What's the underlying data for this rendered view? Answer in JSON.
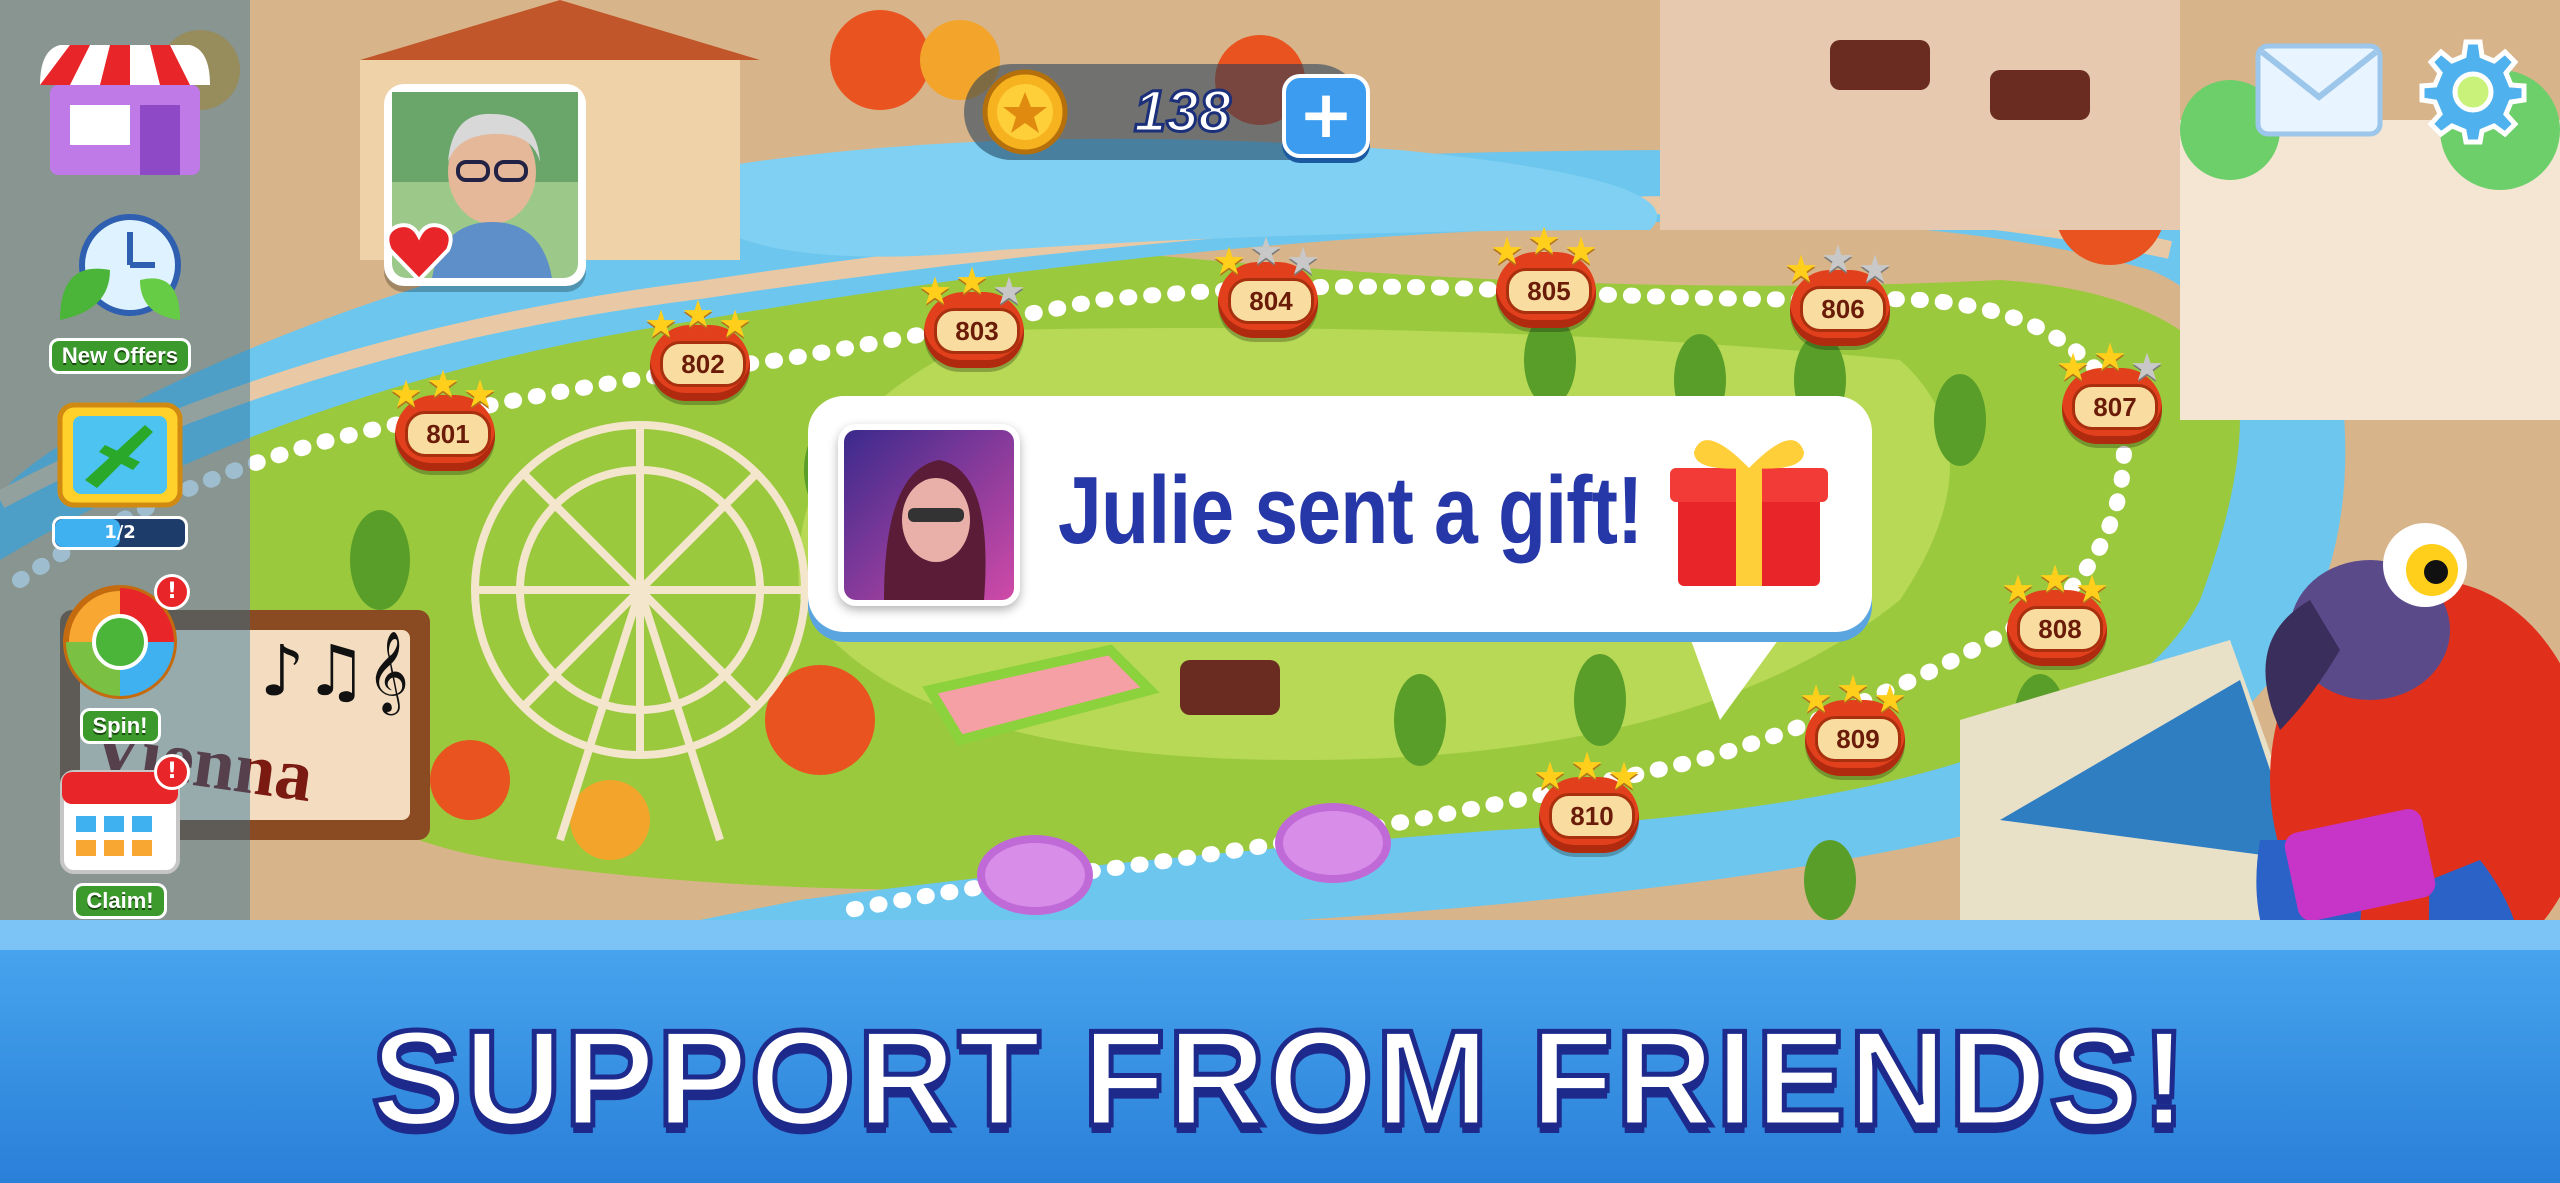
{
  "top_bar": {
    "coins": "138",
    "add_coins_label": "+"
  },
  "sidebar": {
    "items": [
      {
        "label": "New Offers",
        "icon": "clock-leaf-icon"
      },
      {
        "label": "1/2",
        "icon": "airplane-icon"
      },
      {
        "label": "Spin!",
        "icon": "wheel-icon",
        "alert": "!"
      },
      {
        "label": "Claim!",
        "icon": "calendar-icon",
        "alert": "!"
      }
    ]
  },
  "map": {
    "sign_text": "Vienna",
    "levels": [
      {
        "number": "801",
        "stars": 3
      },
      {
        "number": "802",
        "stars": 3
      },
      {
        "number": "803",
        "stars": 2
      },
      {
        "number": "804",
        "stars": 1
      },
      {
        "number": "805",
        "stars": 3
      },
      {
        "number": "806",
        "stars": 1
      },
      {
        "number": "807",
        "stars": 2
      },
      {
        "number": "808",
        "stars": 3
      },
      {
        "number": "809",
        "stars": 3
      },
      {
        "number": "810",
        "stars": 3
      }
    ]
  },
  "notification": {
    "message": "Julie sent a gift!"
  },
  "banner": {
    "title": "SUPPORT FROM FRIENDS!"
  },
  "colors": {
    "level_badge": "#e2401c",
    "banner": "#3a95e8",
    "text_dark_blue": "#2637a8",
    "river": "#6cc6ee"
  }
}
